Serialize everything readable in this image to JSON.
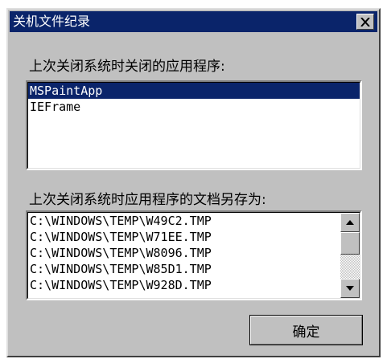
{
  "dialog": {
    "title": "关机文件纪录",
    "close_icon": "close-icon"
  },
  "section1": {
    "label": "上次关闭系统时关闭的应用程序:",
    "items": [
      {
        "text": "MSPaintApp",
        "selected": true
      },
      {
        "text": "IEFrame",
        "selected": false
      }
    ]
  },
  "section2": {
    "label": "上次关闭系统时应用程序的文档另存为:",
    "items": [
      "C:\\WINDOWS\\TEMP\\W49C2.TMP",
      "C:\\WINDOWS\\TEMP\\W71EE.TMP",
      "C:\\WINDOWS\\TEMP\\W8096.TMP",
      "C:\\WINDOWS\\TEMP\\W85D1.TMP",
      "C:\\WINDOWS\\TEMP\\W928D.TMP"
    ]
  },
  "buttons": {
    "ok_label": "确定"
  },
  "colors": {
    "title_bar": "#0a246a",
    "face": "#c0c0c0",
    "selection": "#0a246a"
  }
}
